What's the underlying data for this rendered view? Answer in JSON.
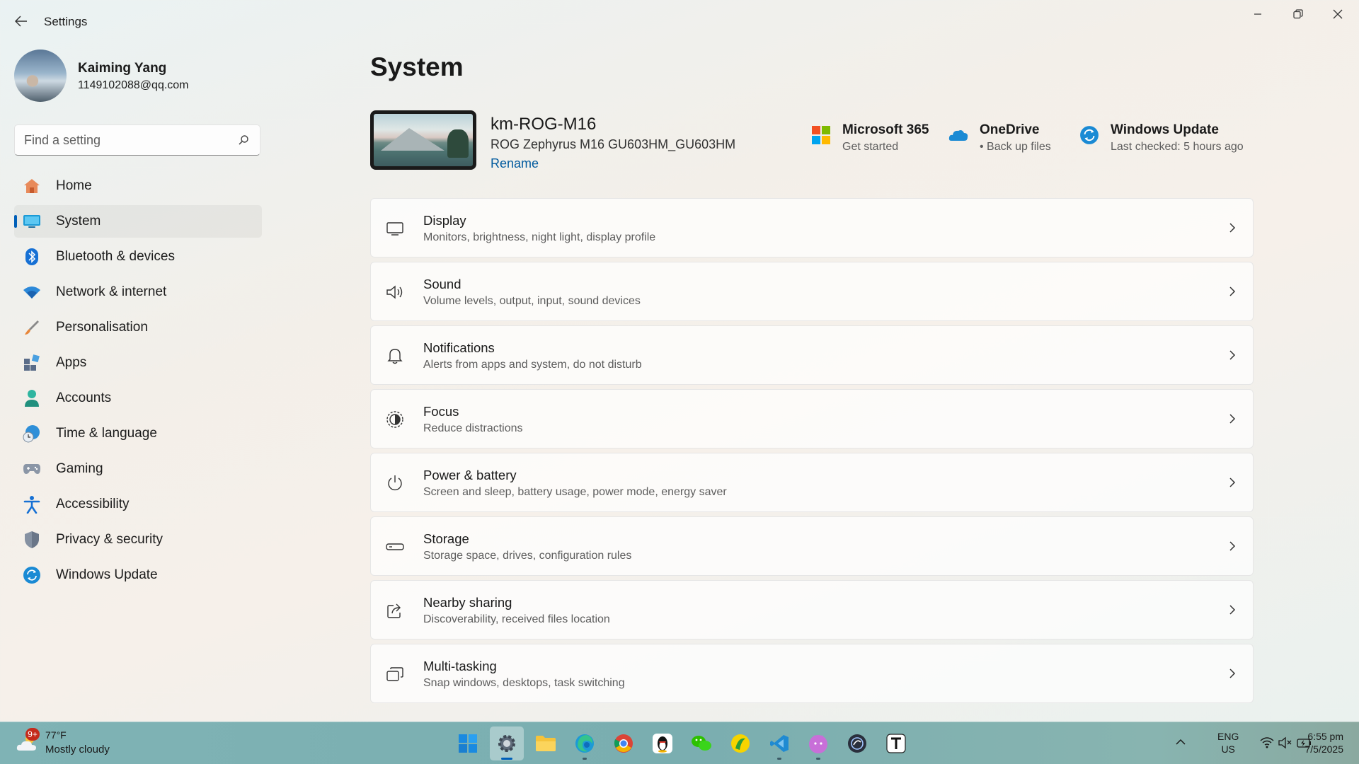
{
  "window": {
    "title": "Settings"
  },
  "profile": {
    "name": "Kaiming Yang",
    "email": "1149102088@qq.com"
  },
  "search": {
    "placeholder": "Find a setting"
  },
  "sidebar": {
    "items": [
      {
        "label": "Home",
        "icon": "home-icon"
      },
      {
        "label": "System",
        "icon": "system-icon",
        "active": true
      },
      {
        "label": "Bluetooth & devices",
        "icon": "bluetooth-icon"
      },
      {
        "label": "Network & internet",
        "icon": "wifi-icon"
      },
      {
        "label": "Personalisation",
        "icon": "brush-icon"
      },
      {
        "label": "Apps",
        "icon": "apps-icon"
      },
      {
        "label": "Accounts",
        "icon": "person-icon"
      },
      {
        "label": "Time & language",
        "icon": "globe-clock-icon"
      },
      {
        "label": "Gaming",
        "icon": "gamepad-icon"
      },
      {
        "label": "Accessibility",
        "icon": "accessibility-icon"
      },
      {
        "label": "Privacy & security",
        "icon": "shield-icon"
      },
      {
        "label": "Windows Update",
        "icon": "update-icon"
      }
    ]
  },
  "main": {
    "title": "System",
    "device": {
      "name": "km-ROG-M16",
      "model": "ROG Zephyrus M16 GU603HM_GU603HM",
      "rename": "Rename"
    },
    "quick": [
      {
        "title": "Microsoft 365",
        "sub": "Get started",
        "icon": "microsoft-logo-icon"
      },
      {
        "title": "OneDrive",
        "sub": "• Back up files",
        "icon": "onedrive-cloud-icon"
      },
      {
        "title": "Windows Update",
        "sub": "Last checked: 5 hours ago",
        "icon": "update-icon"
      }
    ],
    "cards": [
      {
        "title": "Display",
        "desc": "Monitors, brightness, night light, display profile",
        "icon": "display-icon"
      },
      {
        "title": "Sound",
        "desc": "Volume levels, output, input, sound devices",
        "icon": "speaker-icon"
      },
      {
        "title": "Notifications",
        "desc": "Alerts from apps and system, do not disturb",
        "icon": "bell-icon"
      },
      {
        "title": "Focus",
        "desc": "Reduce distractions",
        "icon": "focus-icon"
      },
      {
        "title": "Power & battery",
        "desc": "Screen and sleep, battery usage, power mode, energy saver",
        "icon": "power-icon"
      },
      {
        "title": "Storage",
        "desc": "Storage space, drives, configuration rules",
        "icon": "storage-icon"
      },
      {
        "title": "Nearby sharing",
        "desc": "Discoverability, received files location",
        "icon": "share-icon"
      },
      {
        "title": "Multi-tasking",
        "desc": "Snap windows, desktops, task switching",
        "icon": "multitask-icon"
      }
    ]
  },
  "taskbar": {
    "weather": {
      "badge": "9+",
      "temp": "77°F",
      "condition": "Mostly cloudy"
    },
    "apps": [
      "start",
      "settings",
      "file-explorer",
      "edge",
      "chrome",
      "qq",
      "wechat",
      "app-yellow",
      "vscode",
      "app-cat",
      "app-dark",
      "typora"
    ],
    "lang_top": "ENG",
    "lang_bottom": "US",
    "time": "6:55 pm",
    "date": "7/5/2025"
  },
  "colors": {
    "accent": "#005fb8",
    "link": "#005a9e",
    "taskbar": "#7fb3b5"
  }
}
